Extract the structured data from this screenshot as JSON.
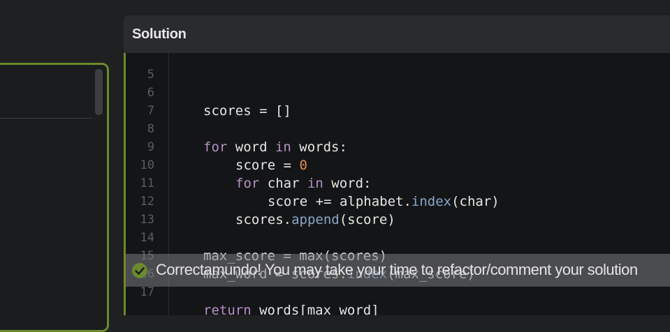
{
  "solution": {
    "title": "Solution"
  },
  "code": {
    "lines": [
      {
        "n": "5",
        "text": ""
      },
      {
        "n": "6",
        "text": "scores = []"
      },
      {
        "n": "7",
        "text": ""
      },
      {
        "n": "8",
        "text": "for word in words:"
      },
      {
        "n": "9",
        "text": "score = 0"
      },
      {
        "n": "10",
        "text": "for char in word:"
      },
      {
        "n": "11",
        "text": "score += alphabet.index(char)"
      },
      {
        "n": "12",
        "text": "scores.append(score)"
      },
      {
        "n": "13",
        "text": ""
      },
      {
        "n": "14",
        "text": "max_score = max(scores)"
      },
      {
        "n": "15",
        "text": "max_word = scores.index(max_score)"
      },
      {
        "n": "16",
        "text": ""
      },
      {
        "n": "17",
        "text": "return words[max_word]"
      }
    ]
  },
  "toast": {
    "message": "Correctamundo! You may take your time to refactor/comment your solution",
    "icon": "check-circle-icon"
  },
  "colors": {
    "accent": "#6b8a2d",
    "keyword": "#b58fc7",
    "number": "#e58a4b",
    "function": "#8aa7c9"
  }
}
